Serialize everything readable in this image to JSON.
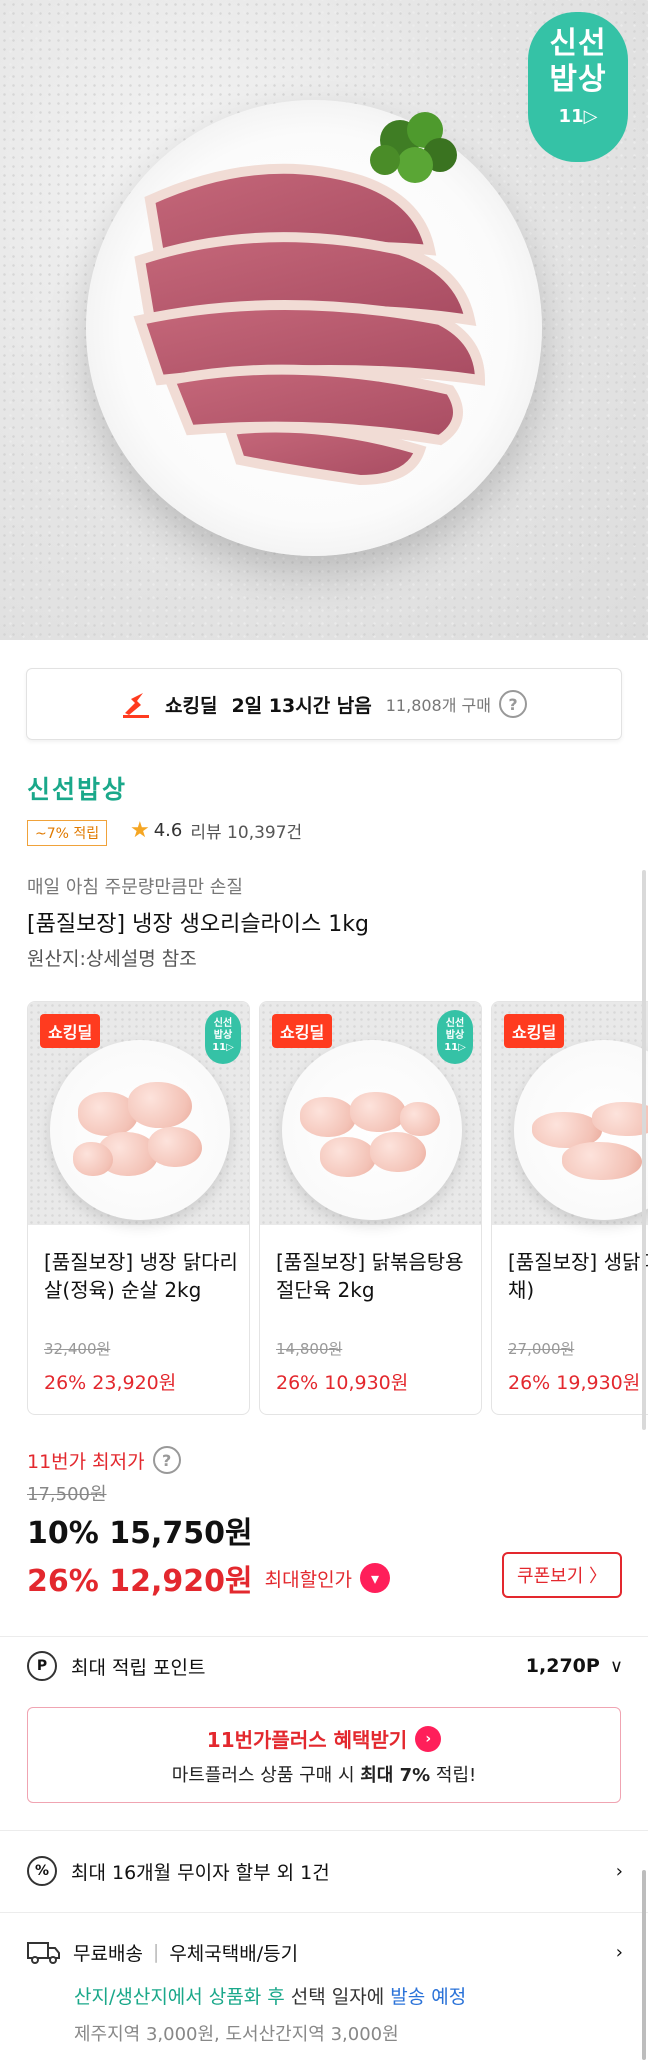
{
  "hero": {
    "badge_text": "신선\n밥상",
    "badge_line1": "신선",
    "badge_line2": "밥상",
    "badge_logo": "11▷"
  },
  "deal_bar": {
    "label": "쇼킹딜",
    "time_left": "2일 13시간 남음",
    "purchases": "11,808개 구매",
    "help_icon": "?"
  },
  "seller": "신선밥상",
  "point_tag": "~7% 적립",
  "rating": {
    "score": "4.6",
    "review_label": "리뷰 10,397건"
  },
  "product": {
    "subcopy": "매일 아침 주문량만큼만 손질",
    "title": "[품질보장]  냉장 생오리슬라이스 1kg",
    "origin": "원산지:상세설명 참조"
  },
  "cards": [
    {
      "tag": "쇼킹딜",
      "badge": "신선\n밥상",
      "name": "[품질보장] 냉장 닭다리살(정육) 순살 2kg",
      "original": "32,400원",
      "price": "26% 23,920원"
    },
    {
      "tag": "쇼킹딜",
      "badge": "신선\n밥상",
      "name": "[품질보장] 닭볶음탕용 절단육 2kg",
      "original": "14,800원",
      "price": "26% 10,930원"
    },
    {
      "tag": "쇼킹딜",
      "badge": "",
      "name": "[품질보장] 생닭다리(북채)",
      "original": "27,000원",
      "price": "26% 19,930원"
    }
  ],
  "pricing": {
    "lowest_label": "11번가 최저가",
    "original": "17,500원",
    "price_10": "10% 15,750원",
    "price_26": "26% 12,920원",
    "max_discount_label": "최대할인가",
    "coupon_button": "쿠폰보기 〉"
  },
  "points": {
    "label": "최대 적립 포인트",
    "value": "1,270P"
  },
  "plus": {
    "title": "11번가플러스 혜택받기",
    "desc_pre": "마트플러스 상품 구매 시 ",
    "desc_bold": "최대 7%",
    "desc_post": " 적립!"
  },
  "installment": {
    "label": "최대 16개월 무이자 할부 외 1건"
  },
  "shipping": {
    "label": "무료배송",
    "sep": "|",
    "carrier": "우체국택배/등기",
    "line2_green1": "산지/생산지에서 상품화 후",
    "line2_dark1": " 선택 일자에 ",
    "line2_blue": "발송 예정",
    "line3": "제주지역 3,000원, 도서산간지역 3,000원"
  },
  "colors": {
    "brand_green": "#35c2a6",
    "sale_red": "#e3282e",
    "deal_red": "#ff3b1f",
    "accent_pink": "#ff1f5a"
  }
}
